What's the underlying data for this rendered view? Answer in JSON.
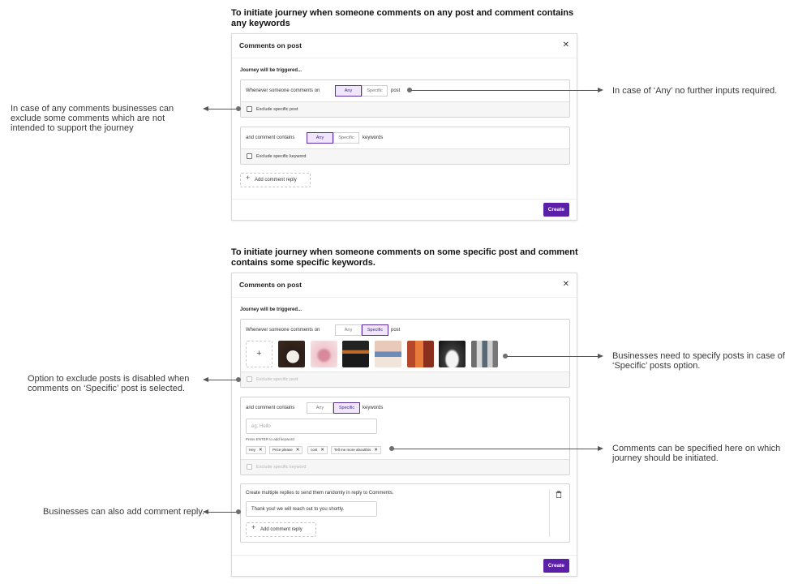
{
  "section1": {
    "heading": "To initiate journey when someone comments on any post and comment contains any keywords",
    "modal": {
      "title": "Comments on post",
      "close_icon": "close-icon",
      "trigger_label": "Journey will be triggered...",
      "post_row": {
        "label": "Whenever someone comments on",
        "any": "Any",
        "specific": "Specific",
        "suffix": "post",
        "selected": "Any",
        "exclude_label": "Exclude specific post"
      },
      "keyword_row": {
        "label": "and comment contains",
        "any": "Any",
        "specific": "Specific",
        "suffix": "keywords",
        "selected": "Any",
        "exclude_label": "Exclude specific keyword"
      },
      "add_reply_label": "Add comment reply",
      "create_label": "Create"
    },
    "notes": {
      "any_note": "In case of ‘Any’ no further inputs required.",
      "exclude_note": "In case of any comments businesses can exclude some comments which are not intended to support the journey"
    }
  },
  "section2": {
    "heading": "To initiate journey when someone comments on some specific post and comment contains some specific keywords.",
    "modal": {
      "title": "Comments on post",
      "close_icon": "close-icon",
      "trigger_label": "Journey will be triggered...",
      "post_row": {
        "label": "Whenever someone comments on",
        "any": "Any",
        "specific": "Specific",
        "suffix": "post",
        "selected": "Specific",
        "exclude_label": "Exclude specific post"
      },
      "keyword_row": {
        "label": "and comment contains",
        "any": "Any",
        "specific": "Specific",
        "suffix": "keywords",
        "selected": "Specific",
        "input_placeholder": "eg. Hello",
        "hint": "Press ENTER to add keyword",
        "chips": [
          "Hey",
          "Price please",
          "cost",
          "Tell me more aboutthis"
        ],
        "exclude_label": "Exclude specific keyword"
      },
      "reply_box": {
        "label": "Create multiple replies to send them randomly in reply to Comments.",
        "reply_value": "Thank you! we will reach out to you shortly.",
        "add_reply_label": "Add comment reply"
      },
      "create_label": "Create"
    },
    "notes": {
      "specific_posts_note": "Businesses need to specify posts in case of ‘Specific’ posts option.",
      "exclude_disabled_note": "Option to exclude posts is disabled when comments on ‘Specific’ post is selected.",
      "keywords_note": "Comments can be specified here on which journey should be initiated.",
      "reply_note": "Businesses can also add comment reply."
    }
  },
  "colors": {
    "accent": "#5b1fa8",
    "selected_fill": "#efe6fb",
    "selected_border": "#5b2ea6"
  }
}
